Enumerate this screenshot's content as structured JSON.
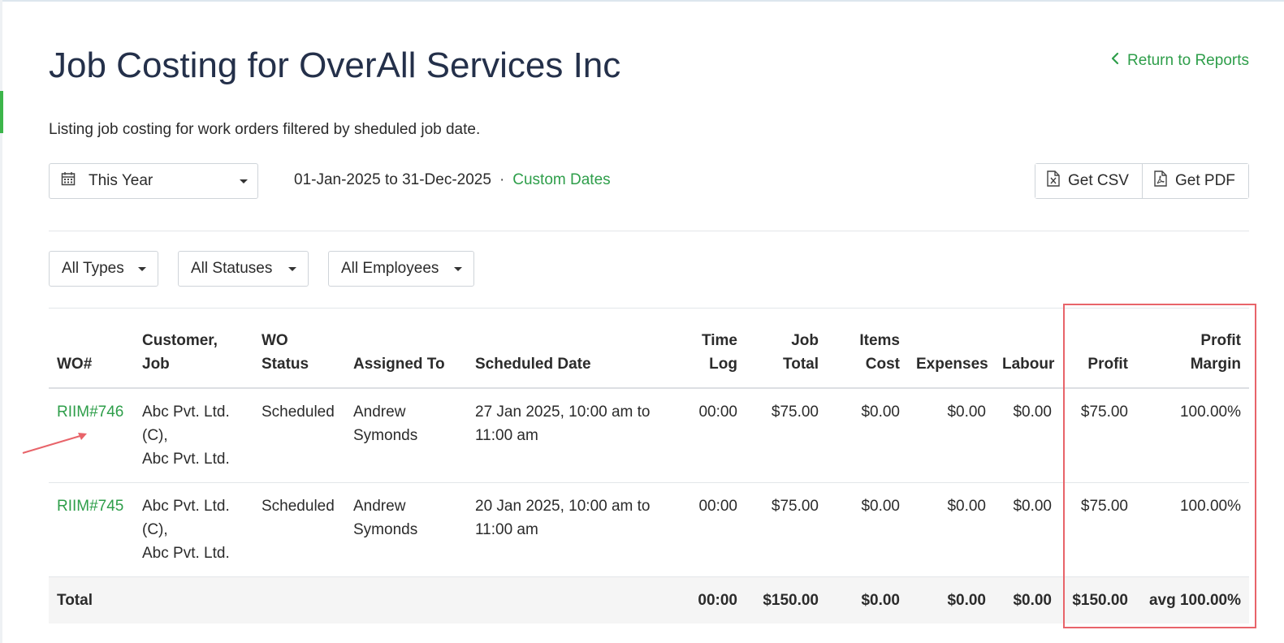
{
  "page": {
    "title": "Job Costing for OverAll Services Inc",
    "subtitle": "Listing job costing for work orders filtered by sheduled job date.",
    "return_link": "Return to Reports"
  },
  "period": {
    "selected": "This Year",
    "date_range": "01-Jan-2025 to 31-Dec-2025",
    "separator": "·",
    "custom_dates": "Custom Dates"
  },
  "export": {
    "csv": "Get CSV",
    "pdf": "Get PDF"
  },
  "filters": {
    "types": "All Types",
    "statuses": "All Statuses",
    "employees": "All Employees"
  },
  "table": {
    "headers": [
      {
        "line1": "",
        "line2": "WO#"
      },
      {
        "line1": "Customer,",
        "line2": "Job"
      },
      {
        "line1": "WO",
        "line2": "Status"
      },
      {
        "line1": "",
        "line2": "Assigned To"
      },
      {
        "line1": "",
        "line2": "Scheduled Date"
      },
      {
        "line1": "Time",
        "line2": "Log"
      },
      {
        "line1": "Job",
        "line2": "Total"
      },
      {
        "line1": "Items",
        "line2": "Cost"
      },
      {
        "line1": "",
        "line2": "Expenses"
      },
      {
        "line1": "",
        "line2": "Labour"
      },
      {
        "line1": "",
        "line2": "Profit"
      },
      {
        "line1": "Profit",
        "line2": "Margin"
      }
    ],
    "rows": [
      {
        "wo": "RIIM#746",
        "customer_line1": "Abc Pvt. Ltd. (C),",
        "customer_line2": "Abc Pvt. Ltd.",
        "status": "Scheduled",
        "assigned": "Andrew Symonds",
        "scheduled": "27 Jan 2025, 10:00 am to 11:00 am",
        "time_log": "00:00",
        "job_total": "$75.00",
        "items_cost": "$0.00",
        "expenses": "$0.00",
        "labour": "$0.00",
        "profit": "$75.00",
        "margin": "100.00%"
      },
      {
        "wo": "RIIM#745",
        "customer_line1": "Abc Pvt. Ltd. (C),",
        "customer_line2": "Abc Pvt. Ltd.",
        "status": "Scheduled",
        "assigned": "Andrew Symonds",
        "scheduled": "20 Jan 2025, 10:00 am to 11:00 am",
        "time_log": "00:00",
        "job_total": "$75.00",
        "items_cost": "$0.00",
        "expenses": "$0.00",
        "labour": "$0.00",
        "profit": "$75.00",
        "margin": "100.00%"
      }
    ],
    "total": {
      "label": "Total",
      "time_log": "00:00",
      "job_total": "$150.00",
      "items_cost": "$0.00",
      "expenses": "$0.00",
      "labour": "$0.00",
      "profit": "$150.00",
      "margin": "avg 100.00%"
    }
  },
  "colors": {
    "accent_green": "#2e9e4a",
    "title_navy": "#24304a",
    "highlight_red": "#e8646a"
  },
  "icons": [
    "chevron-left-icon",
    "calendar-icon",
    "csv-file-icon",
    "pdf-file-icon",
    "caret-down-icon",
    "annotation-arrow"
  ]
}
